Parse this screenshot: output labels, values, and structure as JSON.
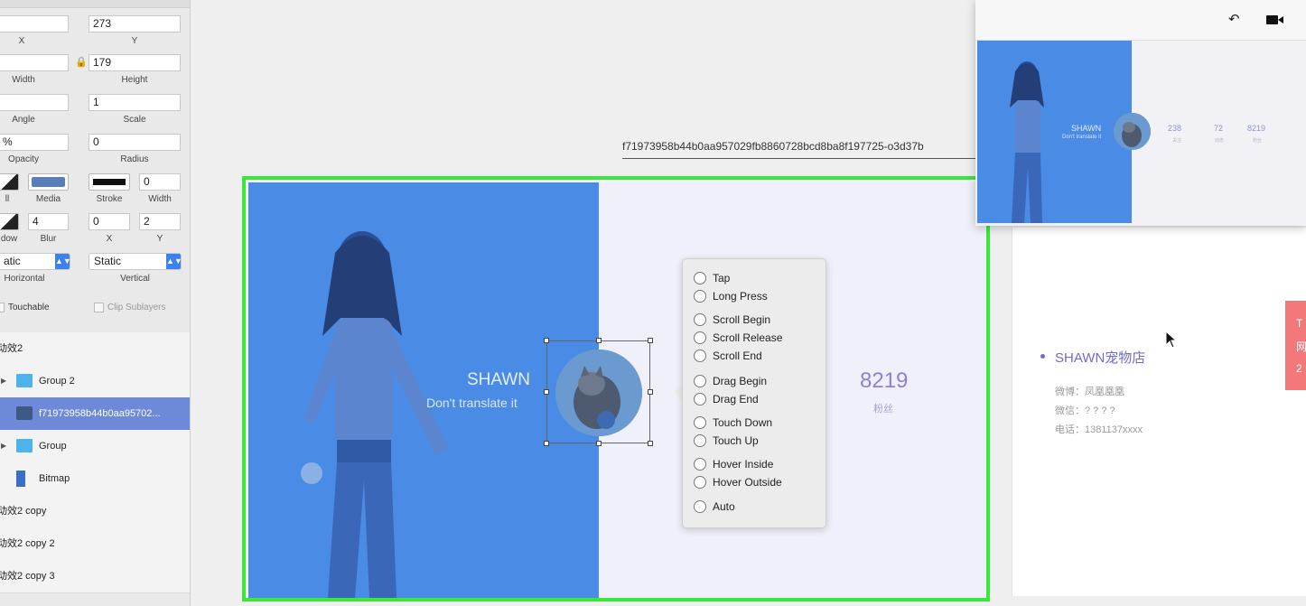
{
  "colors": {
    "accent_blue": "#4a8be6",
    "selection_green": "#39e83b",
    "layer_selected": "#6d89d8",
    "stat_purple": "#8f7fd6"
  },
  "inspector": {
    "x": {
      "value": "",
      "label": "X"
    },
    "y": {
      "value": "273",
      "label": "Y"
    },
    "width": {
      "value": "",
      "label": "Width"
    },
    "height": {
      "value": "179",
      "label": "Height"
    },
    "angle": {
      "value": "",
      "label": "Angle"
    },
    "scale": {
      "value": "1",
      "label": "Scale"
    },
    "opacity": {
      "value": "%",
      "label": "Opacity"
    },
    "radius": {
      "value": "0",
      "label": "Radius"
    },
    "fill_label": "ll",
    "media_label": "Media",
    "stroke_label": "Stroke",
    "stroke_width": {
      "value": "0",
      "label": "Width"
    },
    "shadow_label": "dow",
    "blur": {
      "value": "4",
      "label": "Blur"
    },
    "shadow_x": {
      "value": "0",
      "label": "X"
    },
    "shadow_y": {
      "value": "2",
      "label": "Y"
    },
    "horizontal": {
      "value": "atic",
      "label": "Horizontal"
    },
    "vertical": {
      "value": "Static",
      "label": "Vertical"
    },
    "touchable_label": "Touchable",
    "clip_sublayers_label": "Clip Sublayers",
    "lock_icon": "lock-icon"
  },
  "layers": [
    {
      "name": "动效2",
      "type": "group-header"
    },
    {
      "name": "Group 2",
      "type": "folder"
    },
    {
      "name": "f71973958b44b0aa95702...",
      "type": "image",
      "selected": true
    },
    {
      "name": "Group",
      "type": "folder"
    },
    {
      "name": "Bitmap",
      "type": "image"
    },
    {
      "name": "动效2 copy",
      "type": "group-header"
    },
    {
      "name": "动效2 copy 2",
      "type": "group-header"
    },
    {
      "name": "动效2 copy 3",
      "type": "group-header"
    }
  ],
  "canvas": {
    "url_label": "f71973958b44b0aa957029fb8860728bcd8ba8f197725-o3d37b",
    "profile": {
      "name": "SHAWN",
      "subtitle": "Don't translate it"
    },
    "stat": {
      "value": "8219",
      "label": "粉丝"
    }
  },
  "event_menu": {
    "options": [
      "Tap",
      "Long Press",
      "Scroll Begin",
      "Scroll Release",
      "Scroll End",
      "Drag Begin",
      "Drag End",
      "Touch Down",
      "Touch Up",
      "Hover Inside",
      "Hover Outside",
      "Auto"
    ]
  },
  "preview": {
    "undo_icon": "undo-icon",
    "camera_icon": "video-camera-icon",
    "name": "SHAWN",
    "subtitle": "Don't translate it",
    "stats": [
      {
        "value": "238",
        "label": "关注"
      },
      {
        "value": "72",
        "label": "动态"
      },
      {
        "value": "8219",
        "label": "粉丝"
      }
    ]
  },
  "card": {
    "shop_name": "SHAWN宠物店",
    "weibo": "微博：凤凰凰凰",
    "wechat": "微信：? ? ? ?",
    "phone": "电话：1381137xxxx",
    "red_tab": [
      "T",
      "网",
      "2"
    ]
  }
}
